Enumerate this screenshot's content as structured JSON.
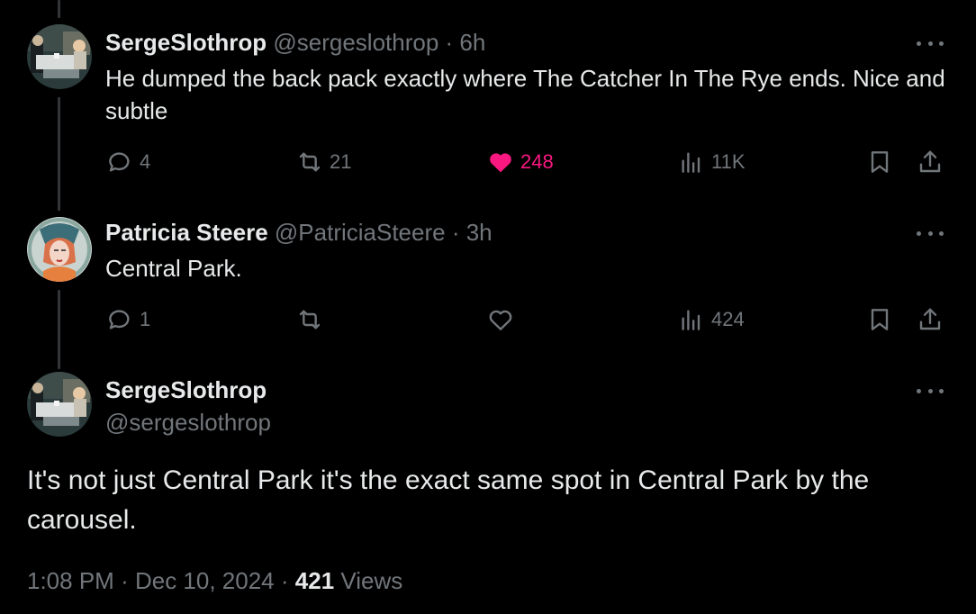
{
  "tweets": [
    {
      "name": "SergeSlothrop",
      "handle": "@sergeslothrop",
      "time": "· 6h",
      "text": "He dumped the back pack exactly where The Catcher In The Rye ends. Nice and subtle",
      "replies": "4",
      "retweets": "21",
      "likes": "248",
      "views": "11K",
      "liked": true
    },
    {
      "name": "Patricia Steere",
      "handle": "@PatriciaSteere",
      "time": "· 3h",
      "text": "Central Park.",
      "replies": "1",
      "retweets": "",
      "likes": "",
      "views": "424",
      "liked": false
    }
  ],
  "main": {
    "name": "SergeSlothrop",
    "handle": "@sergeslothrop",
    "text": "It's not just Central Park it's the exact same spot in Central Park by the carousel.",
    "time": "1:08 PM",
    "date": "Dec 10, 2024",
    "views_count": "421",
    "views_label": "Views",
    "separator": "·"
  },
  "colors": {
    "background": "#000000",
    "text": "#e7e9ea",
    "muted": "#71767b",
    "like": "#f91880",
    "thread_line": "#333639"
  }
}
